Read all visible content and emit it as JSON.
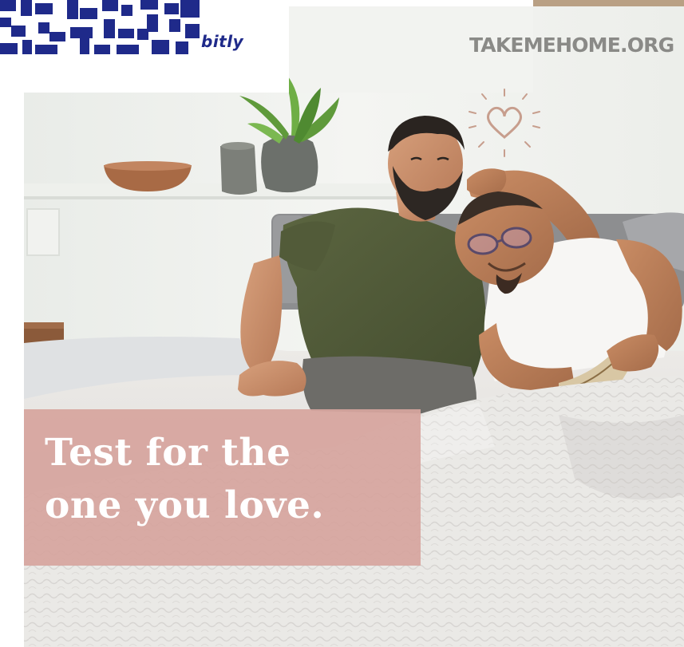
{
  "qr_code": {
    "brand_label": "bitly",
    "ink_color": "#1f2a8a"
  },
  "site": {
    "url_text": "TAKEMEHOME.ORG",
    "color": "#8a8a87"
  },
  "headline": {
    "line1": "Test for the",
    "line2": "one you love.",
    "panel_color": "#d6a59e",
    "text_color": "#ffffff"
  },
  "icons": {
    "heart": "heart-icon",
    "qr": "qr-code-icon"
  }
}
